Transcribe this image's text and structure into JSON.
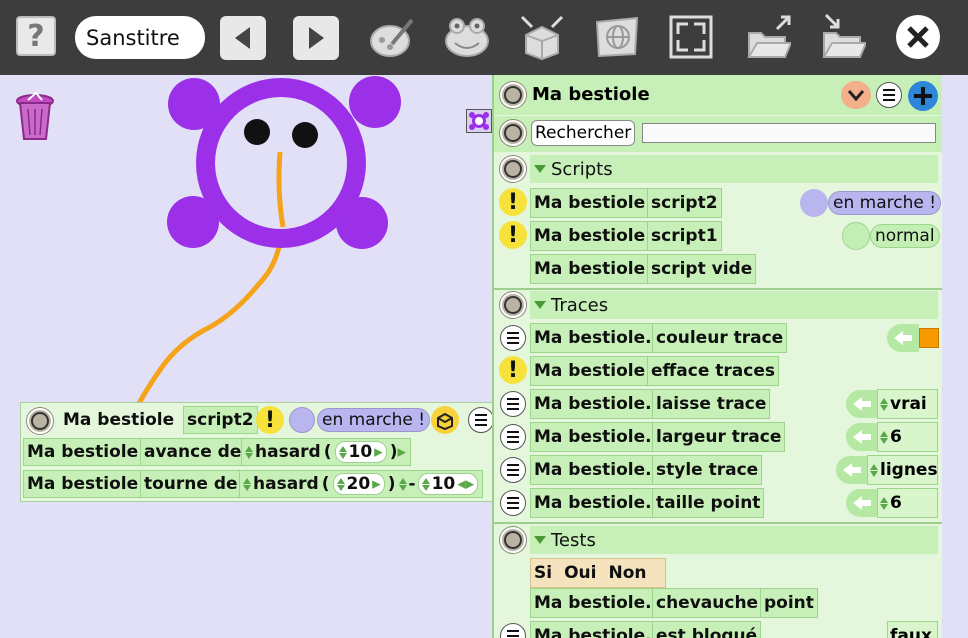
{
  "toolbar": {
    "help_icon": "question-icon",
    "project_title": "Sanstitre",
    "icons": [
      "back-arrow-icon",
      "forward-arrow-icon",
      "paint-icon",
      "frog-icon",
      "open-box-icon",
      "globe-map-icon",
      "fullscreen-icon",
      "open-folder-icon",
      "save-folder-icon",
      "close-icon"
    ]
  },
  "script_box": {
    "header": {
      "object": "Ma bestiole",
      "script": "script2",
      "status": "en marche !"
    },
    "rows": [
      {
        "object": "Ma bestiole",
        "command": "avance de",
        "func": "hasard",
        "arg1": "10"
      },
      {
        "object": "Ma bestiole",
        "command": "tourne de",
        "func": "hasard",
        "arg1": "20",
        "op": "-",
        "arg2": "10"
      }
    ],
    "paren_open": "(",
    "paren_close": ")"
  },
  "panel": {
    "title": "Ma bestiole",
    "search_label": "Rechercher",
    "search_value": "",
    "sections": {
      "scripts": {
        "title": "Scripts",
        "rows": [
          {
            "object": "Ma bestiole",
            "name": "script2",
            "status": "en marche !"
          },
          {
            "object": "Ma bestiole",
            "name": "script1",
            "status": "normal"
          },
          {
            "object": "Ma bestiole",
            "name": "script vide"
          }
        ]
      },
      "traces": {
        "title": "Traces",
        "rows": [
          {
            "object": "Ma bestiole.",
            "name": "couleur trace",
            "value": ""
          },
          {
            "object": "Ma bestiole",
            "name": "efface traces"
          },
          {
            "object": "Ma bestiole.",
            "name": "laisse trace",
            "value": "vrai"
          },
          {
            "object": "Ma bestiole.",
            "name": "largeur trace",
            "value": "6"
          },
          {
            "object": "Ma bestiole.",
            "name": "style trace",
            "value": "lignes"
          },
          {
            "object": "Ma bestiole.",
            "name": "taille point",
            "value": "6"
          }
        ]
      },
      "tests": {
        "title": "Tests",
        "if_block": {
          "si": "Si",
          "oui": "Oui",
          "non": "Non"
        },
        "rows": [
          {
            "object": "Ma bestiole.",
            "name": "chevauche",
            "arg": "point"
          },
          {
            "object": "Ma bestiole.",
            "name": "est bloqué",
            "value": "faux"
          }
        ]
      }
    }
  },
  "colors": {
    "toolbar_bg": "#3d3d3d",
    "canvas_bg": "#e2e0f7",
    "creature": "#9b30e8",
    "trace": "#f5a31a",
    "trace_color_swatch": "#f79a00"
  }
}
